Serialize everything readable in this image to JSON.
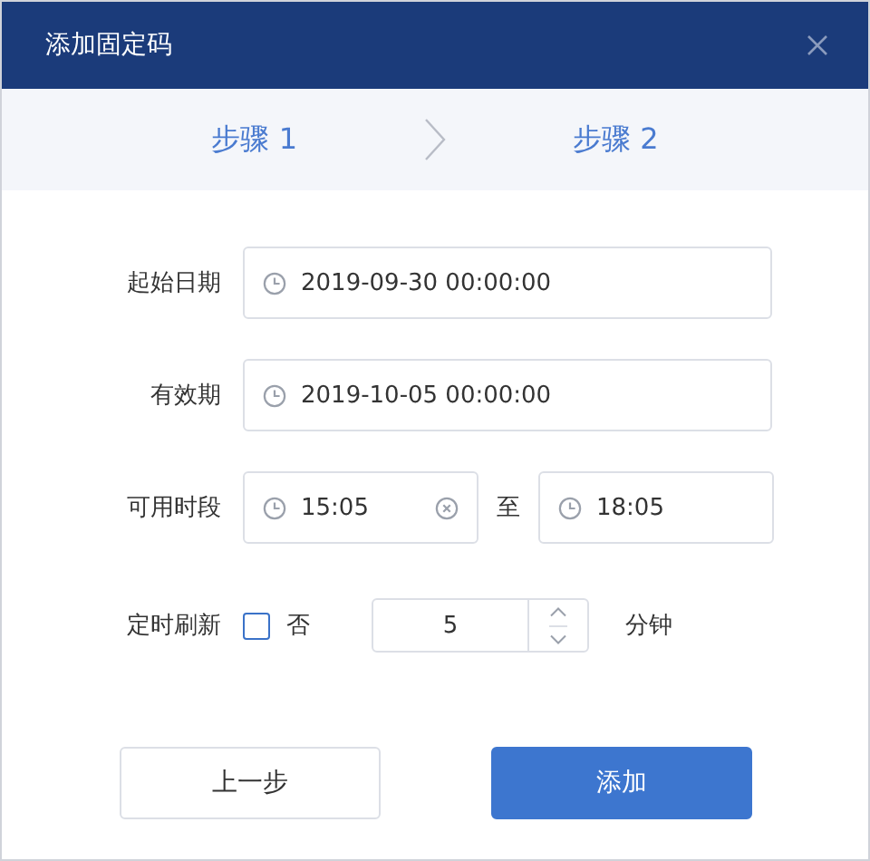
{
  "window": {
    "title": "添加固定码"
  },
  "steps": [
    {
      "label": "步骤 1"
    },
    {
      "label": "步骤 2"
    }
  ],
  "form": {
    "start_date": {
      "label": "起始日期",
      "value": "2019-09-30 00:00:00"
    },
    "valid_until": {
      "label": "有效期",
      "value": "2019-10-05 00:00:00"
    },
    "time_range": {
      "label": "可用时段",
      "from": {
        "value": "15:05",
        "clearable": true
      },
      "separator": "至",
      "to": {
        "value": "18:05",
        "clearable": false
      }
    },
    "refresh": {
      "label": "定时刷新",
      "checked": false,
      "checkbox_label": "否",
      "interval": "5",
      "unit": "分钟"
    }
  },
  "buttons": [
    {
      "label": "上一步",
      "kind": "secondary"
    },
    {
      "label": "添加",
      "kind": "primary"
    }
  ]
}
